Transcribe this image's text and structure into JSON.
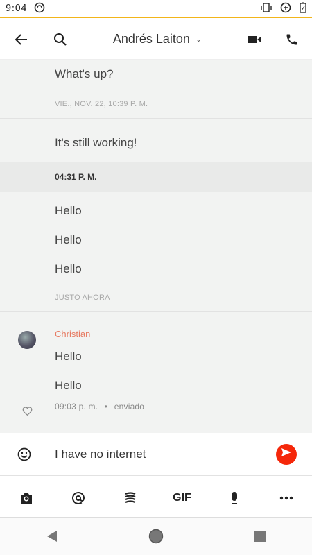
{
  "status_bar": {
    "time": "9:04"
  },
  "header": {
    "contact_name": "Andrés Laiton",
    "chevron": "⌄"
  },
  "conversation": {
    "block1": {
      "message": "What's up?",
      "timestamp": "VIE., NOV. 22, 10:39 P. M."
    },
    "block2": {
      "message": "It's still working!"
    },
    "time_separator": "04:31 P. M.",
    "block3": {
      "messages": [
        "Hello",
        "Hello",
        "Hello"
      ],
      "timestamp": "JUSTO AHORA"
    },
    "block4": {
      "author": "Christian",
      "messages": [
        "Hello",
        "Hello"
      ],
      "time": "09:03 p. m.",
      "separator": "•",
      "status": "enviado"
    }
  },
  "composer": {
    "text_before": "I ",
    "text_underlined": "have",
    "text_after": " no internet"
  },
  "toolbar": {
    "gif_label": "GIF"
  },
  "icons": [
    "back-arrow-icon",
    "search-icon",
    "video-call-icon",
    "phone-icon",
    "emoji-icon",
    "send-icon",
    "camera-icon",
    "at-mention-icon",
    "sticker-icon",
    "gif-icon",
    "microphone-icon",
    "more-icon",
    "heart-icon",
    "nav-back-icon",
    "nav-home-icon",
    "nav-recents-icon"
  ],
  "colors": {
    "accent": "#f5270a",
    "author": "#e77b63",
    "status_line": "#f2b51a",
    "chat_bg": "#f2f3f2"
  }
}
